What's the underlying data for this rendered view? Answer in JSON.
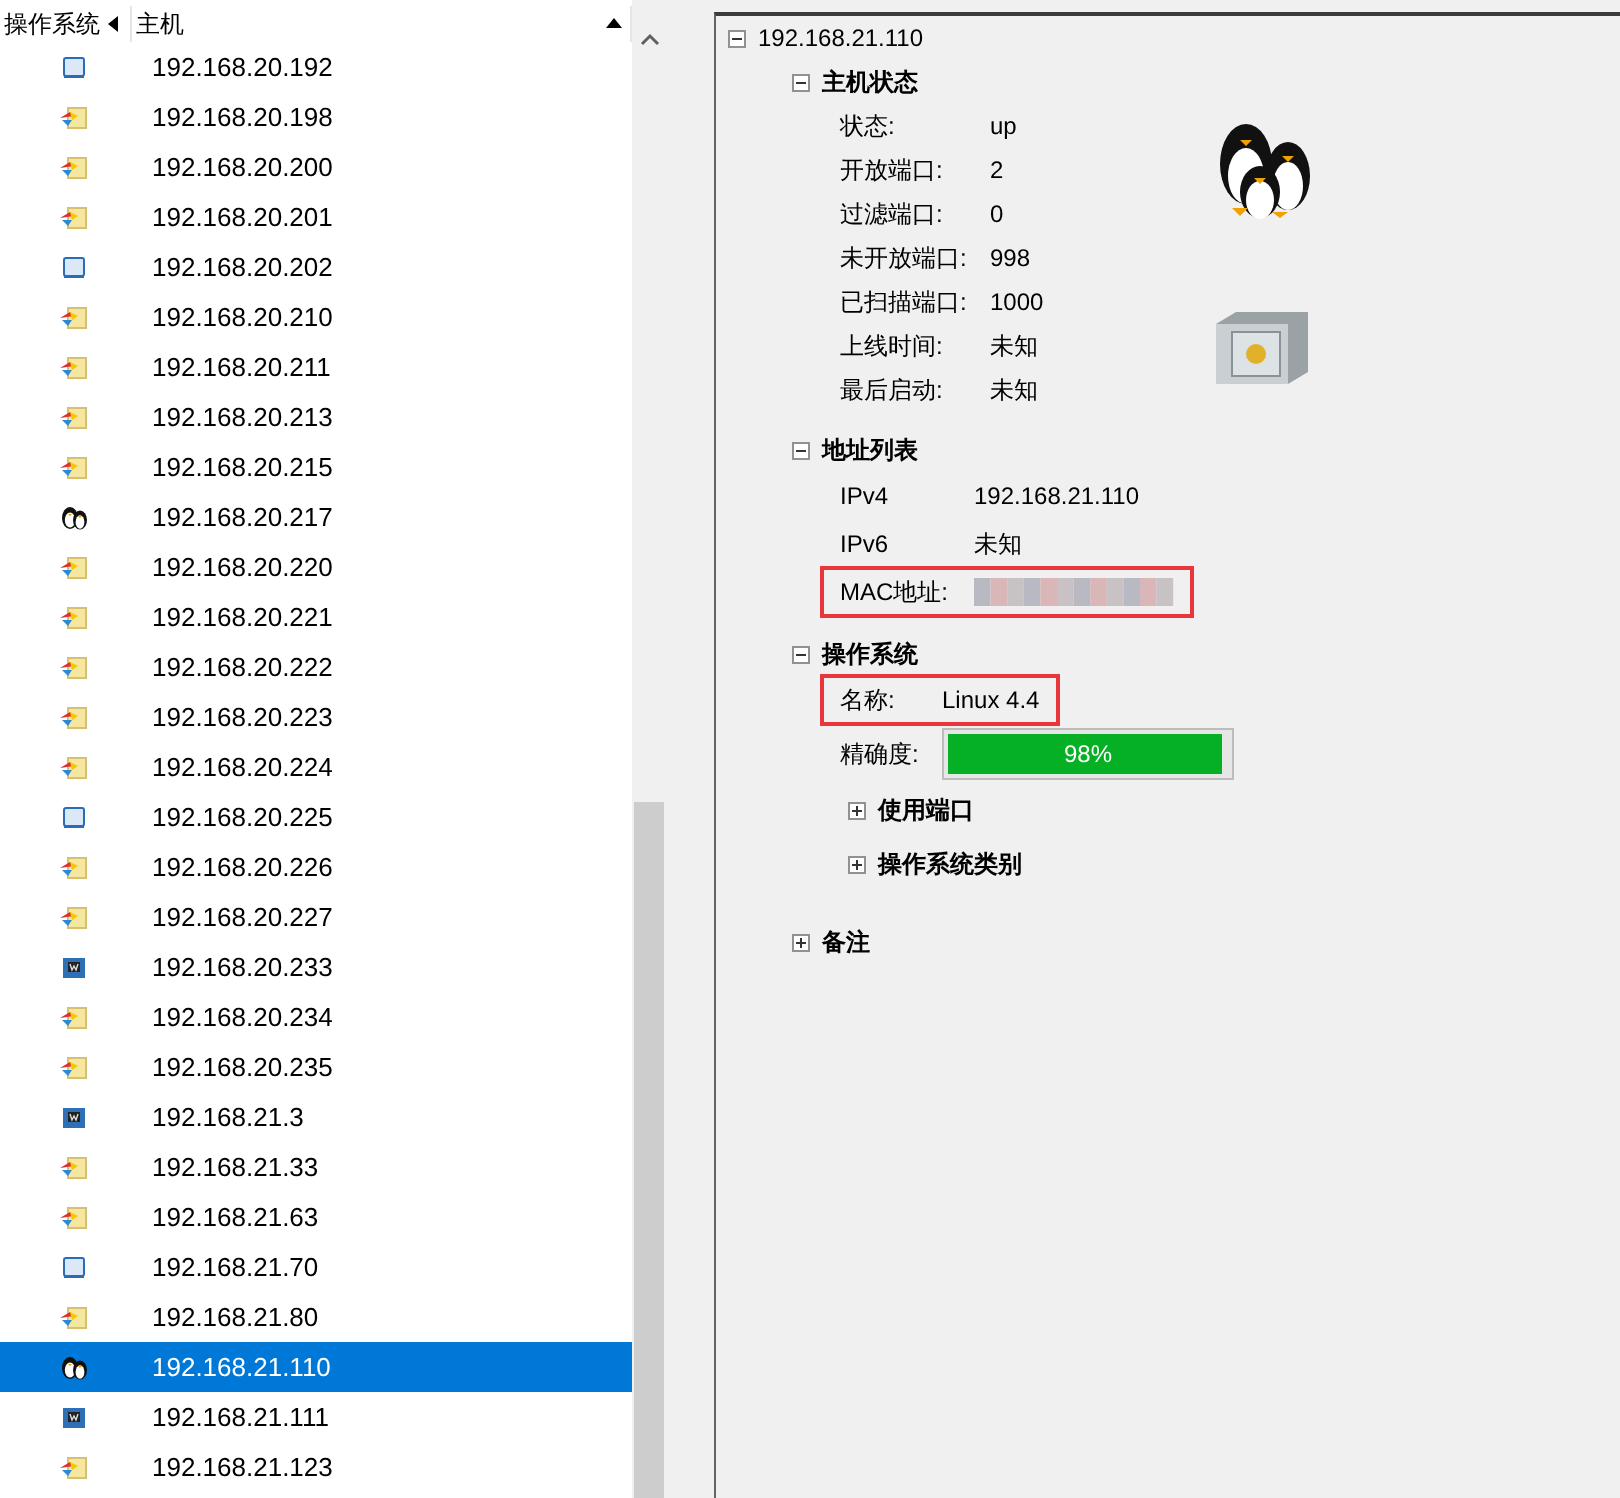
{
  "list": {
    "columns": [
      {
        "label": "操作系统",
        "kind": "left"
      },
      {
        "label": "主机",
        "kind": "up"
      }
    ],
    "rows": [
      {
        "kind": "monitor",
        "host": "192.168.20.192",
        "selected": false
      },
      {
        "kind": "windows",
        "host": "192.168.20.198",
        "selected": false
      },
      {
        "kind": "windows",
        "host": "192.168.20.200",
        "selected": false
      },
      {
        "kind": "windows",
        "host": "192.168.20.201",
        "selected": false
      },
      {
        "kind": "monitor",
        "host": "192.168.20.202",
        "selected": false
      },
      {
        "kind": "windows",
        "host": "192.168.20.210",
        "selected": false
      },
      {
        "kind": "windows",
        "host": "192.168.20.211",
        "selected": false
      },
      {
        "kind": "windows",
        "host": "192.168.20.213",
        "selected": false
      },
      {
        "kind": "windows",
        "host": "192.168.20.215",
        "selected": false
      },
      {
        "kind": "linux",
        "host": "192.168.20.217",
        "selected": false
      },
      {
        "kind": "windows",
        "host": "192.168.20.220",
        "selected": false
      },
      {
        "kind": "windows",
        "host": "192.168.20.221",
        "selected": false
      },
      {
        "kind": "windows",
        "host": "192.168.20.222",
        "selected": false
      },
      {
        "kind": "windows",
        "host": "192.168.20.223",
        "selected": false
      },
      {
        "kind": "windows",
        "host": "192.168.20.224",
        "selected": false
      },
      {
        "kind": "monitor",
        "host": "192.168.20.225",
        "selected": false
      },
      {
        "kind": "windows",
        "host": "192.168.20.226",
        "selected": false
      },
      {
        "kind": "windows",
        "host": "192.168.20.227",
        "selected": false
      },
      {
        "kind": "device",
        "host": "192.168.20.233",
        "selected": false
      },
      {
        "kind": "windows",
        "host": "192.168.20.234",
        "selected": false
      },
      {
        "kind": "windows",
        "host": "192.168.20.235",
        "selected": false
      },
      {
        "kind": "device",
        "host": "192.168.21.3",
        "selected": false
      },
      {
        "kind": "windows",
        "host": "192.168.21.33",
        "selected": false
      },
      {
        "kind": "windows",
        "host": "192.168.21.63",
        "selected": false
      },
      {
        "kind": "monitor",
        "host": "192.168.21.70",
        "selected": false
      },
      {
        "kind": "windows",
        "host": "192.168.21.80",
        "selected": false
      },
      {
        "kind": "linux",
        "host": "192.168.21.110",
        "selected": true
      },
      {
        "kind": "device",
        "host": "192.168.21.111",
        "selected": false
      },
      {
        "kind": "windows",
        "host": "192.168.21.123",
        "selected": false
      }
    ]
  },
  "details": {
    "host": "192.168.21.110",
    "expanded": true,
    "sections": [
      {
        "kind": "status",
        "title": "主机状态",
        "expanded": true,
        "fields": [
          {
            "label": "状态:",
            "value": "up"
          },
          {
            "label": "开放端口:",
            "value": "2"
          },
          {
            "label": "过滤端口:",
            "value": "0"
          },
          {
            "label": "未开放端口:",
            "value": "998"
          },
          {
            "label": "已扫描端口:",
            "value": "1000"
          },
          {
            "label": "上线时间:",
            "value": "未知"
          },
          {
            "label": "最后启动:",
            "value": "未知"
          }
        ]
      },
      {
        "kind": "address",
        "title": "地址列表",
        "expanded": true,
        "fields": [
          {
            "label": "IPv4",
            "value": "192.168.21.110",
            "highlighted": false
          },
          {
            "label": "IPv6",
            "value": "未知",
            "highlighted": false
          },
          {
            "label": "MAC地址:",
            "redacted": true,
            "highlighted": true
          }
        ]
      },
      {
        "kind": "os",
        "title": "操作系统",
        "expanded": true,
        "fields": [
          {
            "label": "名称:",
            "value": "Linux 4.4",
            "highlighted": true
          }
        ],
        "accuracy": {
          "label": "精确度:",
          "level": 0.98,
          "reading": "98%"
        },
        "subsections": [
          {
            "title": "使用端口",
            "expanded": false
          },
          {
            "title": "操作系统类别",
            "expanded": false
          }
        ]
      },
      {
        "kind": "notes",
        "title": "备注",
        "expanded": false
      }
    ]
  }
}
